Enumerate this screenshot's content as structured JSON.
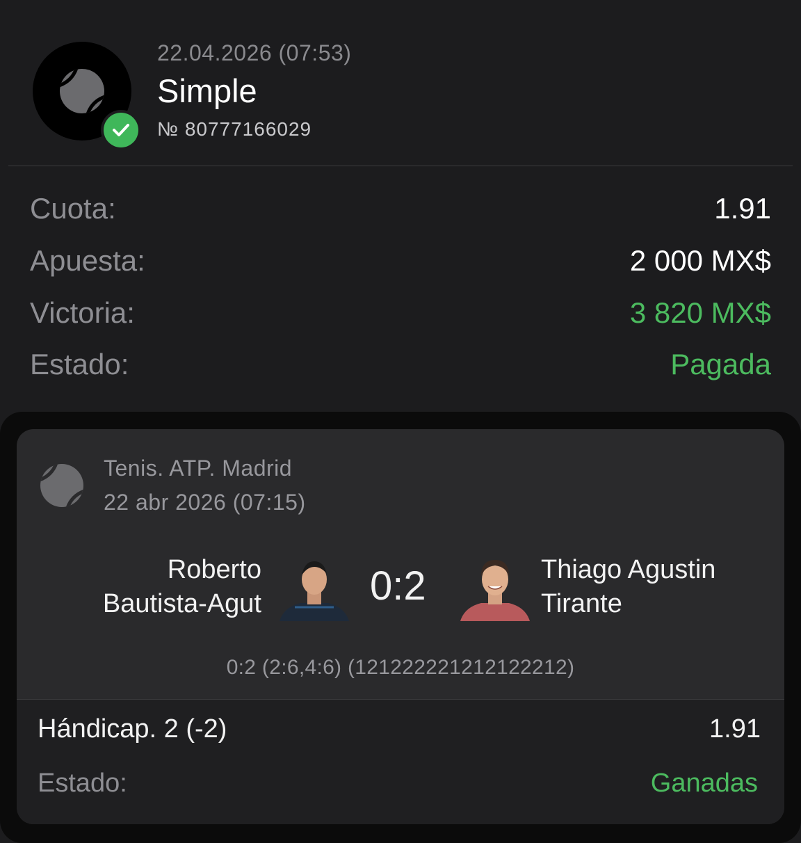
{
  "header": {
    "datetime": "22.04.2026 (07:53)",
    "bet_type": "Simple",
    "bet_number": "№ 80777166029",
    "sport_icon": "tennis-ball-icon",
    "status_icon": "check-icon",
    "status_color": "#3fb75a"
  },
  "summary": {
    "odds_label": "Cuota:",
    "odds_value": "1.91",
    "stake_label": "Apuesta:",
    "stake_value": "2 000 MX$",
    "win_label": "Victoria:",
    "win_value": "3 820 MX$",
    "state_label": "Estado:",
    "state_value": "Pagada",
    "positive_color": "#4cbb5f"
  },
  "event": {
    "league": "Tenis. ATP. Madrid",
    "date": "22 abr 2026 (07:15)",
    "sport_icon": "tennis-ball-icon",
    "player1": {
      "first": "Roberto",
      "last": "Bautista-Agut",
      "avatar_icon": "player-avatar"
    },
    "player2": {
      "first": "Thiago Agustin",
      "last": "Tirante",
      "avatar_icon": "player-avatar"
    },
    "score": "0:2",
    "sets": "0:2 (2:6,4:6) (121222221212122212)",
    "market": "Hándicap. 2 (-2)",
    "market_odds": "1.91",
    "state_label": "Estado:",
    "state_value": "Ganadas"
  }
}
